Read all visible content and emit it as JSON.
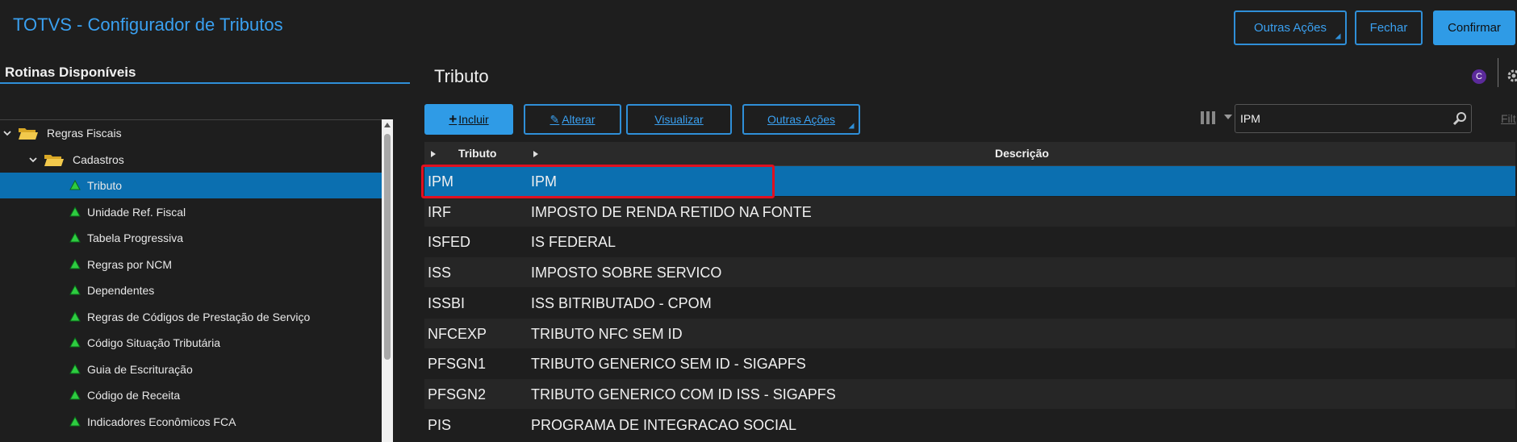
{
  "header": {
    "title": "TOTVS - Configurador de Tributos",
    "outras_acoes": "Outras Ações",
    "fechar": "Fechar",
    "confirmar": "Confirmar"
  },
  "left": {
    "title": "Rotinas Disponíveis",
    "tree": [
      {
        "label": "Regras Fiscais",
        "type": "folder",
        "expanded": true
      },
      {
        "label": "Cadastros",
        "type": "folder",
        "expanded": true
      },
      {
        "label": "Tributo",
        "type": "leaf",
        "selected": true
      },
      {
        "label": "Unidade Ref. Fiscal",
        "type": "leaf"
      },
      {
        "label": "Tabela Progressiva",
        "type": "leaf"
      },
      {
        "label": "Regras por NCM",
        "type": "leaf"
      },
      {
        "label": "Dependentes",
        "type": "leaf"
      },
      {
        "label": "Regras de Códigos de Prestação de Serviço",
        "type": "leaf"
      },
      {
        "label": "Código Situação Tributária",
        "type": "leaf"
      },
      {
        "label": "Guia de Escrituração",
        "type": "leaf"
      },
      {
        "label": "Código de Receita",
        "type": "leaf"
      },
      {
        "label": "Indicadores Econômicos FCA",
        "type": "leaf"
      }
    ]
  },
  "main": {
    "title": "Tributo",
    "c_icon": "C",
    "toolbar": {
      "incluir": "Incluir",
      "alterar": "Alterar",
      "visualizar": "Visualizar",
      "outras_acoes": "Outras Ações"
    },
    "search_value": "IPM",
    "filter_label": "Filt",
    "columns": {
      "tributo": "Tributo",
      "descricao": "Descrição"
    },
    "rows": [
      {
        "tributo": "IPM",
        "descricao": "IPM",
        "selected": true
      },
      {
        "tributo": "IRF",
        "descricao": "IMPOSTO DE RENDA RETIDO NA FONTE"
      },
      {
        "tributo": "ISFED",
        "descricao": "IS FEDERAL"
      },
      {
        "tributo": "ISS",
        "descricao": "IMPOSTO SOBRE SERVICO"
      },
      {
        "tributo": "ISSBI",
        "descricao": "ISS BITRIBUTADO - CPOM"
      },
      {
        "tributo": "NFCEXP",
        "descricao": "TRIBUTO NFC SEM ID"
      },
      {
        "tributo": "PFSGN1",
        "descricao": "TRIBUTO GENERICO SEM ID - SIGAPFS"
      },
      {
        "tributo": "PFSGN2",
        "descricao": "TRIBUTO GENERICO COM ID ISS - SIGAPFS"
      },
      {
        "tributo": "PIS",
        "descricao": "PROGRAMA DE INTEGRACAO SOCIAL"
      }
    ]
  },
  "colors": {
    "accent": "#2f9be6",
    "selected_row": "#0b6fb0",
    "highlight": "#e01020",
    "leaf_icon": "#2ecc40"
  }
}
